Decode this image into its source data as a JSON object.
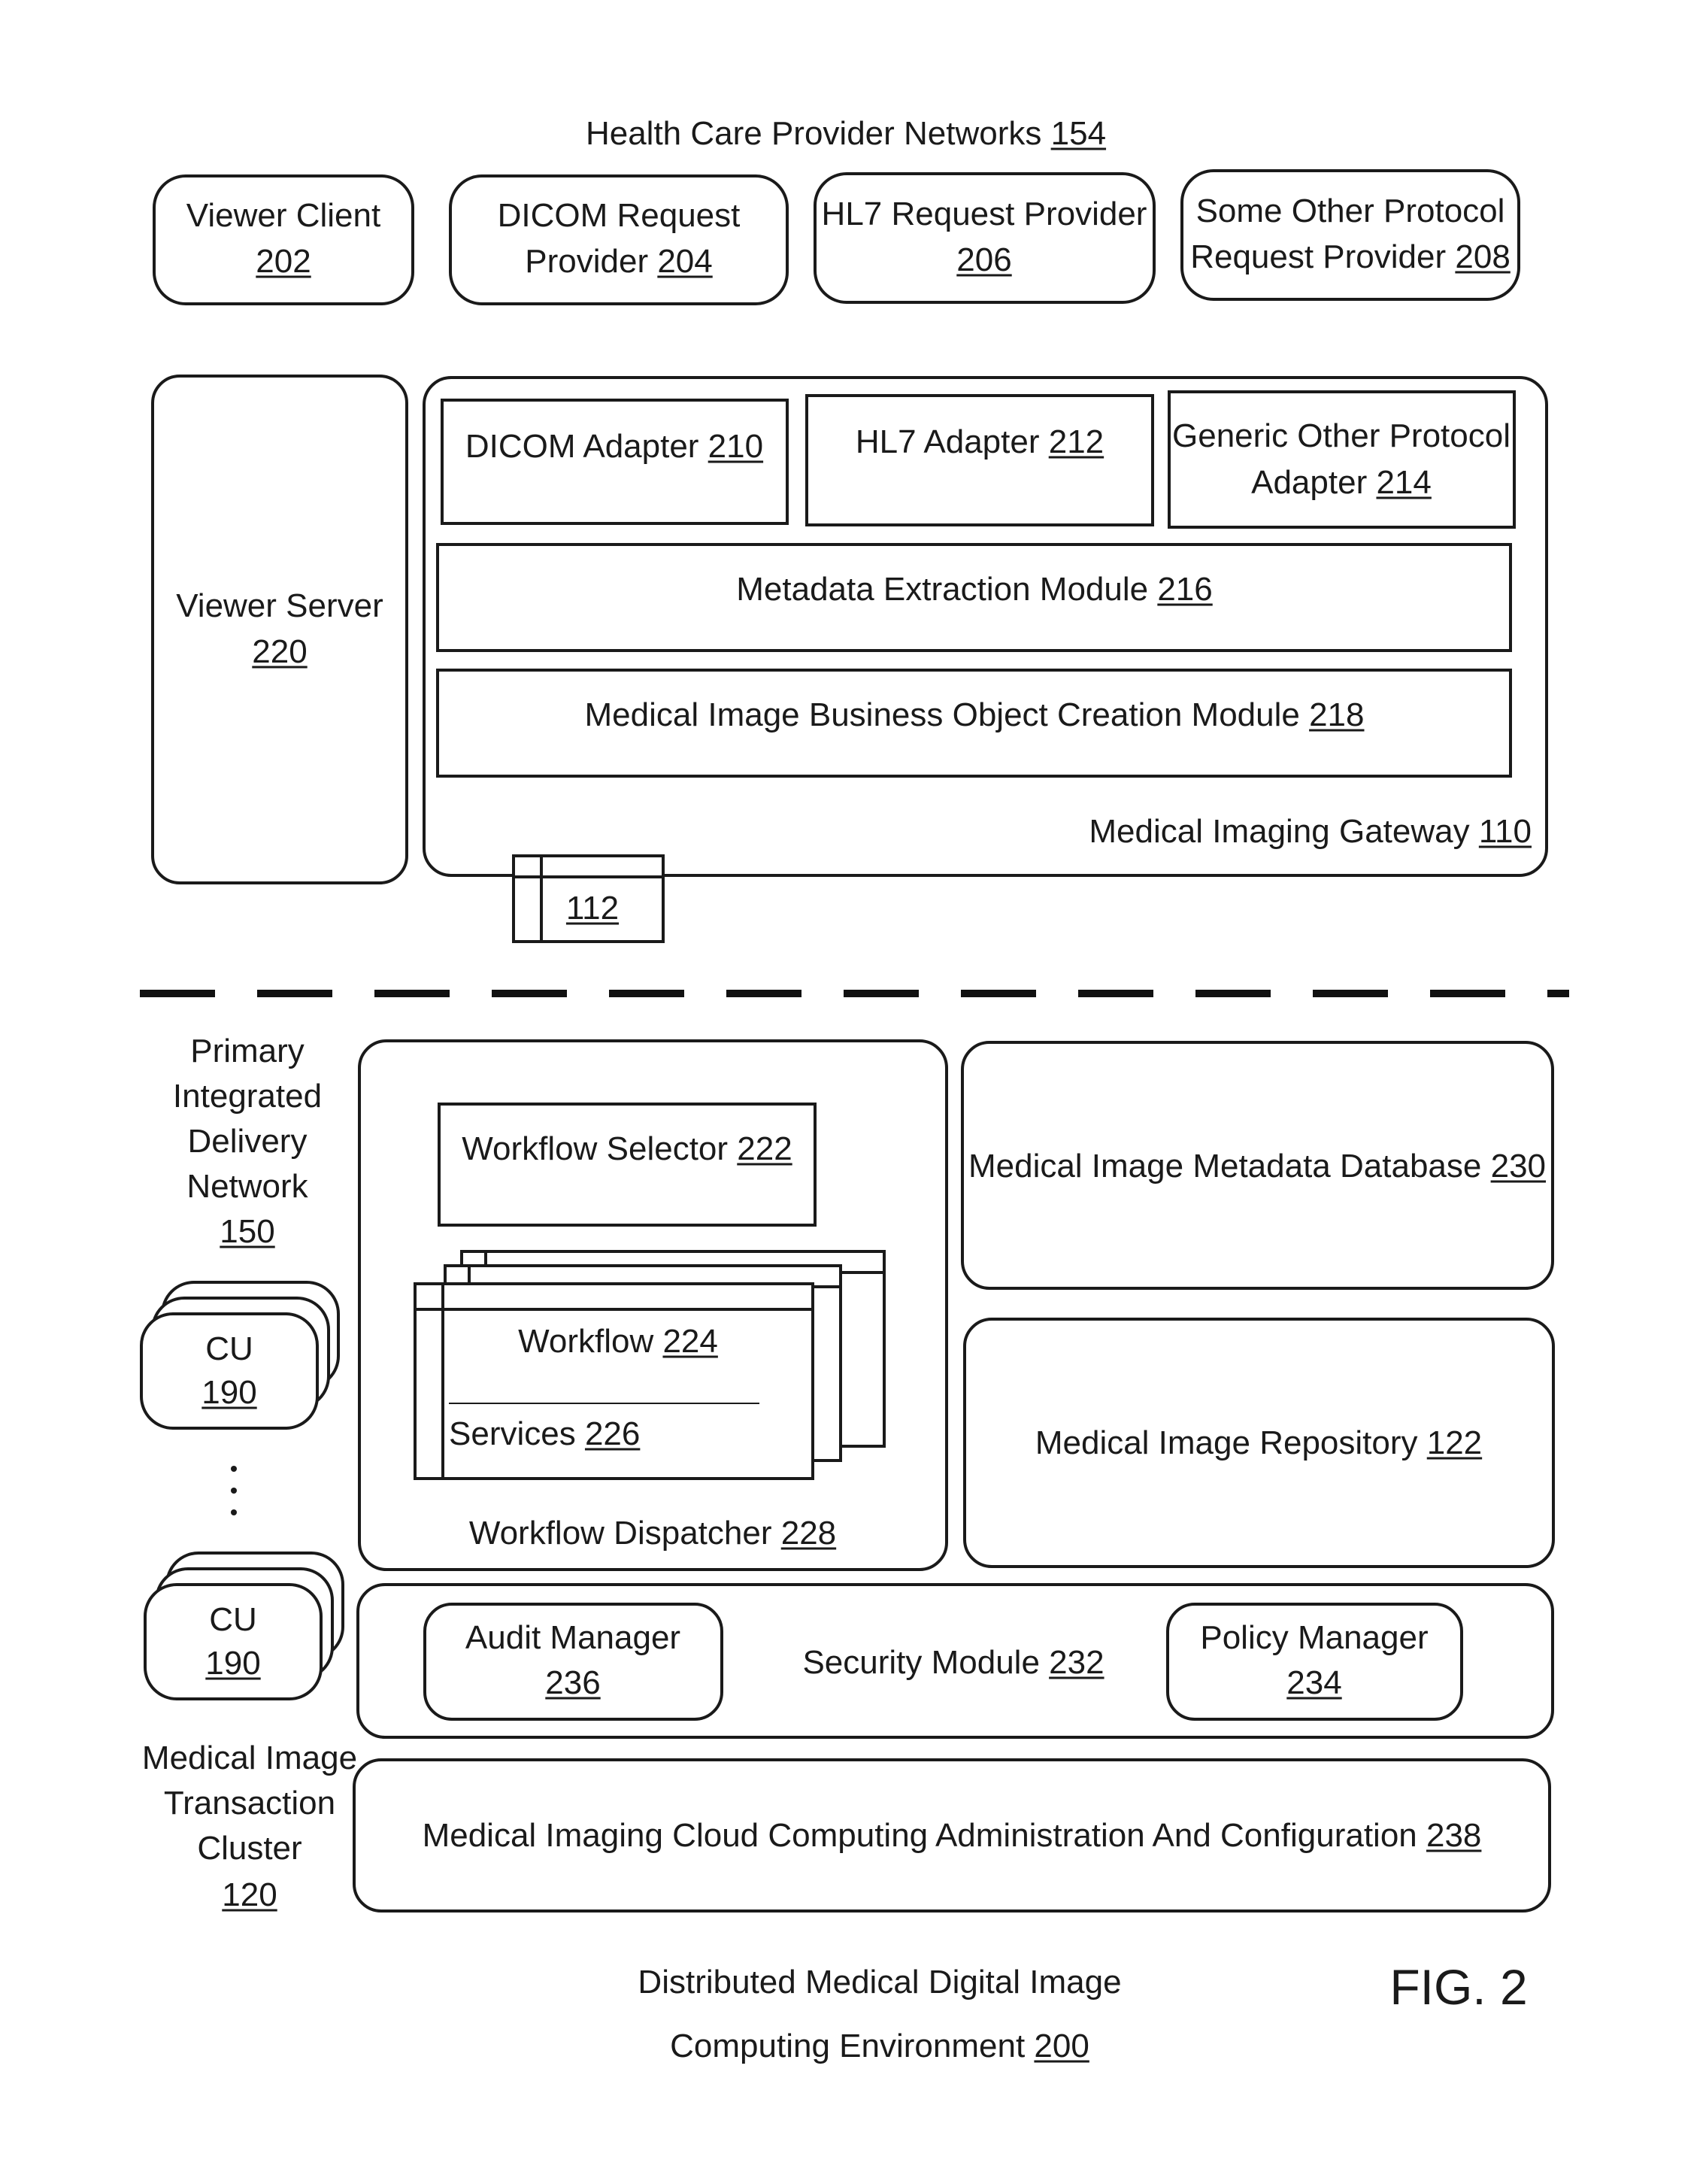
{
  "figure": {
    "label": "FIG. 2",
    "caption_line1": "Distributed Medical Digital Image",
    "caption_line2_text": "Computing Environment ",
    "caption_line2_ref": "200"
  },
  "health_care_networks": {
    "title_text": "Health Care Provider Networks ",
    "title_ref": "154",
    "providers": [
      {
        "line1": "Viewer Client",
        "line2_text": "",
        "ref": "202"
      },
      {
        "line1": "DICOM Request",
        "line2_text": "Provider ",
        "ref": "204"
      },
      {
        "line1": "HL7 Request Provider",
        "line2_text": "",
        "ref": "206"
      },
      {
        "line1": "Some Other Protocol",
        "line2_text": "Request Provider ",
        "ref": "208"
      }
    ]
  },
  "viewer_server": {
    "line1": "Viewer Server",
    "ref": "220"
  },
  "gateway": {
    "label_text": "Medical Imaging Gateway ",
    "label_ref": "110",
    "adapters": [
      {
        "line1_text": "DICOM Adapter ",
        "ref": "210"
      },
      {
        "line1_text": "HL7 Adapter ",
        "ref": "212"
      },
      {
        "line1": "Generic Other Protocol",
        "line2_text": "Adapter ",
        "ref": "214"
      }
    ],
    "metadata_module": {
      "text": "Metadata Extraction Module ",
      "ref": "216"
    },
    "business_object_module": {
      "text": "Medical Image Business Object Creation Module ",
      "ref": "218"
    },
    "connector": {
      "ref": "112"
    }
  },
  "idn": {
    "lines": [
      "Primary",
      "Integrated",
      "Delivery",
      "Network"
    ],
    "ref": "150"
  },
  "compute_units": [
    {
      "label": "CU",
      "ref": "190"
    },
    {
      "label": "CU",
      "ref": "190"
    }
  ],
  "cluster": {
    "lines": [
      "Medical Image",
      "Transaction",
      "Cluster"
    ],
    "ref": "120"
  },
  "workflow_dispatcher": {
    "label_text": "Workflow Dispatcher ",
    "label_ref": "228",
    "selector": {
      "text": "Workflow Selector ",
      "ref": "222"
    },
    "workflow": {
      "text": "Workflow ",
      "ref": "224"
    },
    "services": {
      "text": "Services ",
      "ref": "226"
    }
  },
  "metadata_database": {
    "text": "Medical Image Metadata Database ",
    "ref": "230"
  },
  "repository": {
    "text": "Medical Image Repository ",
    "ref": "122"
  },
  "security_module": {
    "text": "Security Module ",
    "ref": "232",
    "audit_manager": {
      "line1": "Audit Manager",
      "ref": "236"
    },
    "policy_manager": {
      "line1": "Policy Manager",
      "ref": "234"
    }
  },
  "administration": {
    "text": "Medical Imaging Cloud Computing Administration And Configuration ",
    "ref": "238"
  }
}
